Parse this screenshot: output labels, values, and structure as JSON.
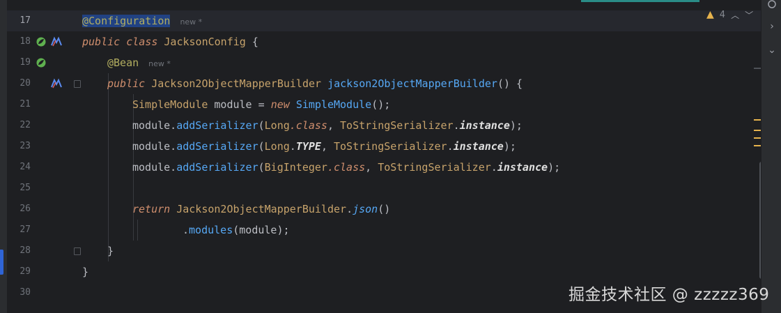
{
  "inspection": {
    "warning_count": "4"
  },
  "lines": [
    {
      "num": "17"
    },
    {
      "num": "18"
    },
    {
      "num": "19"
    },
    {
      "num": "20"
    },
    {
      "num": "21"
    },
    {
      "num": "22"
    },
    {
      "num": "23"
    },
    {
      "num": "24"
    },
    {
      "num": "25"
    },
    {
      "num": "26"
    },
    {
      "num": "27"
    },
    {
      "num": "28"
    },
    {
      "num": "29"
    },
    {
      "num": "30"
    }
  ],
  "code": {
    "l17_annotation": "@Configuration",
    "l17_hint": "new *",
    "l18_public": "public",
    "l18_class": "class",
    "l18_name": "JacksonConfig",
    "l18_brace": " {",
    "l19_annotation": "@Bean",
    "l19_hint": "new *",
    "l20_public": "public",
    "l20_type": "Jackson2ObjectMapperBuilder",
    "l20_method": "jackson2ObjectMapperBuilder",
    "l20_rest": "() {",
    "l21_type": "SimpleModule",
    "l21_var": " module = ",
    "l21_new": "new",
    "l21_ctor": "SimpleModule",
    "l21_rest": "();",
    "l22_obj": "module.",
    "l22_method": "addSerializer",
    "l22_open": "(",
    "l22_cls": "Long",
    "l22_dotclass": ".class",
    "l22_comma": ", ",
    "l22_ser": "ToStringSerializer",
    "l22_dot": ".",
    "l22_inst": "instance",
    "l22_close": ");",
    "l23_obj": "module.",
    "l23_method": "addSerializer",
    "l23_open": "(",
    "l23_cls": "Long",
    "l23_dot1": ".",
    "l23_type": "TYPE",
    "l23_comma": ", ",
    "l23_ser": "ToStringSerializer",
    "l23_dot": ".",
    "l23_inst": "instance",
    "l23_close": ");",
    "l24_obj": "module.",
    "l24_method": "addSerializer",
    "l24_open": "(",
    "l24_cls": "BigInteger",
    "l24_dotclass": ".class",
    "l24_comma": ", ",
    "l24_ser": "ToStringSerializer",
    "l24_dot": ".",
    "l24_inst": "instance",
    "l24_close": ");",
    "l26_return": "return",
    "l26_cls": "Jackson2ObjectMapperBuilder",
    "l26_dot": ".",
    "l26_json": "json",
    "l26_close": "()",
    "l27_dot": ".",
    "l27_method": "modules",
    "l27_rest": "(module);",
    "l28_brace": "}",
    "l29_brace": "}"
  },
  "watermark": "掘金技术社区 @ zzzzz369",
  "colors": {
    "background": "#1e1f22",
    "keyword": "#cf8e6d",
    "annotation": "#b3ae60",
    "method": "#56a8f5",
    "field": "#c77dbb",
    "warning": "#e6b34d"
  }
}
